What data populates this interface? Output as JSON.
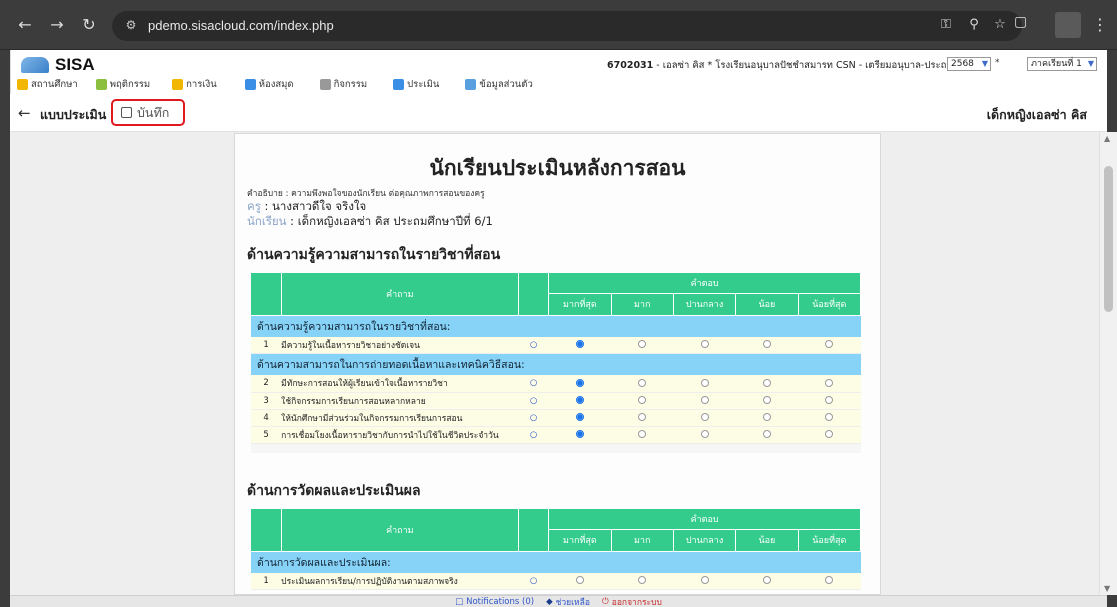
{
  "browser": {
    "url": "pdemo.sisacloud.com/index.php"
  },
  "header": {
    "logo_text": "SISA",
    "session_id": "6702031",
    "session_rest": " - เอลซ่า คิส * โรงเรียนอนุบาลปัชชำสมารท CSN - เตรียมอนุบาล-ประถมศึกษา *",
    "year_value": "2568",
    "term_value": "ภาคเรียนที่ 1",
    "menu": [
      {
        "label": "สถานศึกษา",
        "icon": "school-icon",
        "color": "#f2b705"
      },
      {
        "label": "พฤติกรรม",
        "icon": "behavior-icon",
        "color": "#8cbf3f"
      },
      {
        "label": "การเงิน",
        "icon": "finance-icon",
        "color": "#f2b705"
      },
      {
        "label": "ห้องสมุด",
        "icon": "library-icon",
        "color": "#3a8ee6"
      },
      {
        "label": "กิจกรรม",
        "icon": "activity-icon",
        "color": "#777777"
      },
      {
        "label": "ประเมิน",
        "icon": "evaluate-icon",
        "color": "#3a8ee6"
      },
      {
        "label": "ข้อมูลส่วนตัว",
        "icon": "profile-icon",
        "color": "#5aa0e0"
      }
    ]
  },
  "toolbar": {
    "title": "แบบประเมิน",
    "save_label": "บันทึก",
    "student_name": "เด็กหญิงเอลซ่า คิส"
  },
  "form": {
    "title": "นักเรียนประเมินหลังการสอน",
    "description": "คำอธิบาย : ความพึงพอใจของนักเรียน ต่อคุณภาพการสอนของครู",
    "teacher_label": "ครู",
    "teacher_value": " : นางสาวดีใจ จริงใจ",
    "student_label": "นักเรียน",
    "student_value": " : เด็กหญิงเอลซ่า คิส ประถมศึกษาปีที่ 6/1",
    "col_question": "คำถาม",
    "col_answer": "คำตอบ",
    "options": [
      "มากที่สุด",
      "มาก",
      "ปานกลาง",
      "น้อย",
      "น้อยที่สุด"
    ],
    "sections": [
      {
        "heading": "ด้านความรู้ความสามารถในรายวิชาที่สอน",
        "groups": [
          {
            "name": "ด้านความรู้ความสามารถในรายวิชาที่สอน:",
            "questions": [
              {
                "num": "1",
                "text": "มีความรู้ในเนื้อหารายวิชาอย่างชัดเจน",
                "selected": 0
              }
            ]
          },
          {
            "name": "ด้านความสามารถในการถ่ายทอดเนื้อหาและเทคนิควิธีสอน:",
            "questions": [
              {
                "num": "2",
                "text": "มีทักษะการสอนให้ผู้เรียนเข้าใจเนื้อหารายวิชา",
                "selected": 0
              },
              {
                "num": "3",
                "text": "ใช้กิจกรรมการเรียนการสอนหลากหลาย",
                "selected": 0
              },
              {
                "num": "4",
                "text": "ให้นักศึกษามีส่วนร่วมในกิจกรรมการเรียนการสอน",
                "selected": 0
              },
              {
                "num": "5",
                "text": "การเชื่อมโยงเนื้อหารายวิชากับการนำไปใช้ในชีวิตประจำวัน",
                "selected": 0
              }
            ]
          }
        ]
      },
      {
        "heading": "ด้านการวัดผลและประเมินผล",
        "groups": [
          {
            "name": "ด้านการวัดผลและประเมินผล:",
            "questions": [
              {
                "num": "1",
                "text": "ประเมินผลการเรียน/การปฏิบัติงานตามสภาพจริง",
                "selected": -1
              }
            ]
          }
        ]
      }
    ]
  },
  "footer": {
    "notifications": "Notifications (0)",
    "help": "ช่วยเหลือ",
    "logout": "ออกจากระบบ"
  },
  "colors": {
    "table_header": "#33cc8c",
    "category_row": "#87d3f7",
    "question_row": "#fdfde6",
    "highlight": "#e0191f"
  }
}
